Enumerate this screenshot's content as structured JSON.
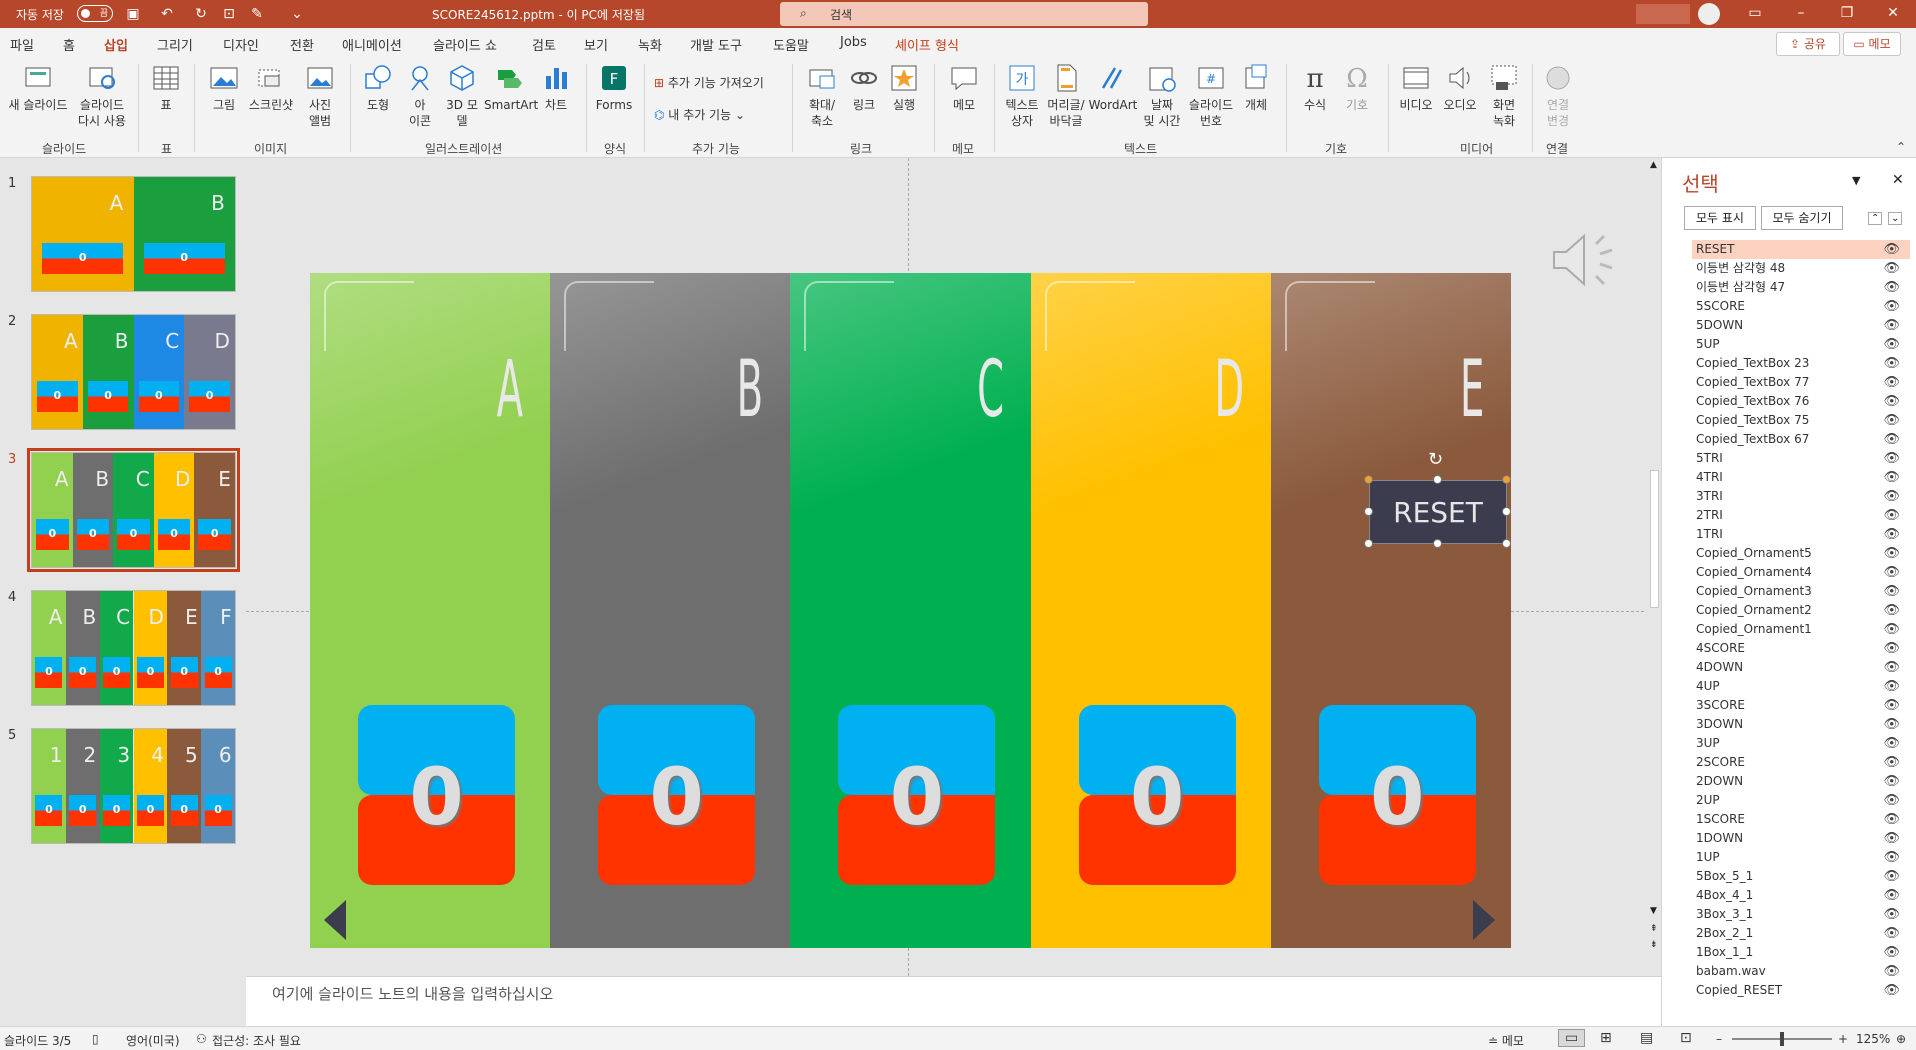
{
  "titlebar": {
    "autosave_label": "자동 저장",
    "autosave_state": "끔",
    "filename": "SCORE245612.pptm - 이 PC에 저장됨",
    "search_placeholder": "검색"
  },
  "tabs": [
    "파일",
    "홈",
    "삽입",
    "그리기",
    "디자인",
    "전환",
    "애니메이션",
    "슬라이드 쇼",
    "검토",
    "보기",
    "녹화",
    "개발 도구",
    "도움말",
    "Jobs",
    "셰이프 형식"
  ],
  "active_tab": "삽입",
  "share_label": "공유",
  "memo_label": "메모",
  "ribbon": {
    "buttons": {
      "new_slide": "새 슬라이드",
      "reuse_slide": "슬라이드\n다시 사용",
      "table": "표",
      "picture": "그림",
      "screenshot": "스크린샷",
      "photo_album": "사진\n앨범",
      "shapes": "도형",
      "icons": "아\n이콘",
      "model3d": "3D 모\n델",
      "smartart": "SmartArt",
      "chart": "차트",
      "forms": "Forms",
      "get_addins": "추가 기능 가져오기",
      "my_addins": "내 추가 기능",
      "zoom": "확대/\n축소",
      "link": "링크",
      "action": "실행",
      "comment": "메모",
      "textbox": "텍스트\n상자",
      "header_footer": "머리글/\n바닥글",
      "wordart": "WordArt",
      "datetime": "날짜\n및 시간",
      "slide_number": "슬라이드\n번호",
      "object": "개체",
      "equation": "수식",
      "symbol": "기호",
      "video": "비디오",
      "audio": "오디오",
      "screen_record": "화면\n녹화",
      "link_change": "연결\n변경"
    },
    "groups": [
      "슬라이드",
      "표",
      "이미지",
      "일러스트레이션",
      "양식",
      "추가 기능",
      "링크",
      "메모",
      "텍스트",
      "기호",
      "미디어",
      "연결"
    ]
  },
  "thumbnails": [
    {
      "number": "1",
      "cols": [
        {
          "color": "#f0b400",
          "letter": "A"
        },
        {
          "color": "#1a9e3e",
          "letter": "B"
        }
      ]
    },
    {
      "number": "2",
      "cols": [
        {
          "color": "#f0b400",
          "letter": "A"
        },
        {
          "color": "#1a9e3e",
          "letter": "B"
        },
        {
          "color": "#1e88e5",
          "letter": "C"
        },
        {
          "color": "#7a7a8e",
          "letter": "D"
        }
      ]
    },
    {
      "number": "3",
      "cols": [
        {
          "color": "#92d050",
          "letter": "A"
        },
        {
          "color": "#6e6e6e",
          "letter": "B"
        },
        {
          "color": "#12a94a",
          "letter": "C"
        },
        {
          "color": "#ffc000",
          "letter": "D"
        },
        {
          "color": "#8b5a3c",
          "letter": "E"
        }
      ]
    },
    {
      "number": "4",
      "cols": [
        {
          "color": "#92d050",
          "letter": "A"
        },
        {
          "color": "#6e6e6e",
          "letter": "B"
        },
        {
          "color": "#12a94a",
          "letter": "C"
        },
        {
          "color": "#ffc000",
          "letter": "D"
        },
        {
          "color": "#8b5a3c",
          "letter": "E"
        },
        {
          "color": "#5b8fb9",
          "letter": "F"
        }
      ]
    },
    {
      "number": "5",
      "cols": [
        {
          "color": "#92d050",
          "letter": "1"
        },
        {
          "color": "#6e6e6e",
          "letter": "2"
        },
        {
          "color": "#12a94a",
          "letter": "3"
        },
        {
          "color": "#ffc000",
          "letter": "4"
        },
        {
          "color": "#8b5a3c",
          "letter": "5"
        },
        {
          "color": "#5b8fb9",
          "letter": "6"
        }
      ]
    }
  ],
  "selected_thumbnail": "3",
  "slide": {
    "columns": [
      {
        "letter": "A",
        "color": "#92d050",
        "score": "0"
      },
      {
        "letter": "B",
        "color": "#6e6e6e",
        "score": "0"
      },
      {
        "letter": "C",
        "color": "#00b050",
        "score": "0"
      },
      {
        "letter": "D",
        "color": "#ffc000",
        "score": "0"
      },
      {
        "letter": "E",
        "color": "#8b5a3c",
        "score": "0"
      }
    ],
    "reset_label": "RESET"
  },
  "notes_placeholder": "여기에 슬라이드 노트의 내용을 입력하십시오",
  "selection_pane": {
    "title": "선택",
    "show_all": "모두 표시",
    "hide_all": "모두 숨기기",
    "items": [
      "RESET",
      "이등변 삼각형 48",
      "이등변 삼각형 47",
      "5SCORE",
      "5DOWN",
      "5UP",
      "Copied_TextBox 23",
      "Copied_TextBox 77",
      "Copied_TextBox 76",
      "Copied_TextBox 75",
      "Copied_TextBox 67",
      "5TRI",
      "4TRI",
      "3TRI",
      "2TRI",
      "1TRI",
      "Copied_Ornament5",
      "Copied_Ornament4",
      "Copied_Ornament3",
      "Copied_Ornament2",
      "Copied_Ornament1",
      "4SCORE",
      "4DOWN",
      "4UP",
      "3SCORE",
      "3DOWN",
      "3UP",
      "2SCORE",
      "2DOWN",
      "2UP",
      "1SCORE",
      "1DOWN",
      "1UP",
      "5Box_5_1",
      "4Box_4_1",
      "3Box_3_1",
      "2Box_2_1",
      "1Box_1_1",
      "babam.wav",
      "Copied_RESET"
    ]
  },
  "status": {
    "slide_of": "슬라이드 3/5",
    "language": "영어(미국)",
    "accessibility": "접근성: 조사 필요",
    "notes_btn": "메모",
    "zoom": "125%"
  }
}
